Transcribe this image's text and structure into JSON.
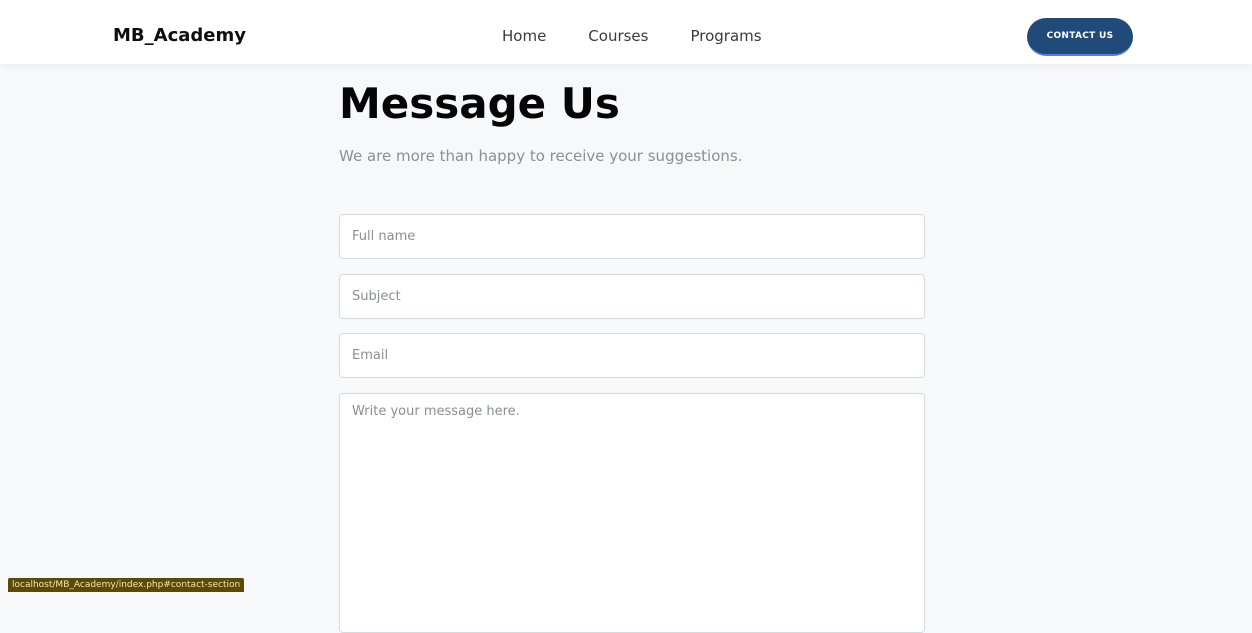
{
  "navbar": {
    "brand": "MB_Academy",
    "links": [
      "Home",
      "Courses",
      "Programs"
    ],
    "contact_button": "CONTACT US"
  },
  "main": {
    "title": "Message Us",
    "subtitle": "We are more than happy to receive your suggestions.",
    "fields": {
      "full_name_placeholder": "Full name",
      "subject_placeholder": "Subject",
      "email_placeholder": "Email",
      "message_placeholder": "Write your message here."
    }
  },
  "status_bar": {
    "url": "localhost/MB_Academy/index.php#contact-section"
  },
  "colors": {
    "accent": "#1f4a7a",
    "background": "#f7f8fa"
  }
}
